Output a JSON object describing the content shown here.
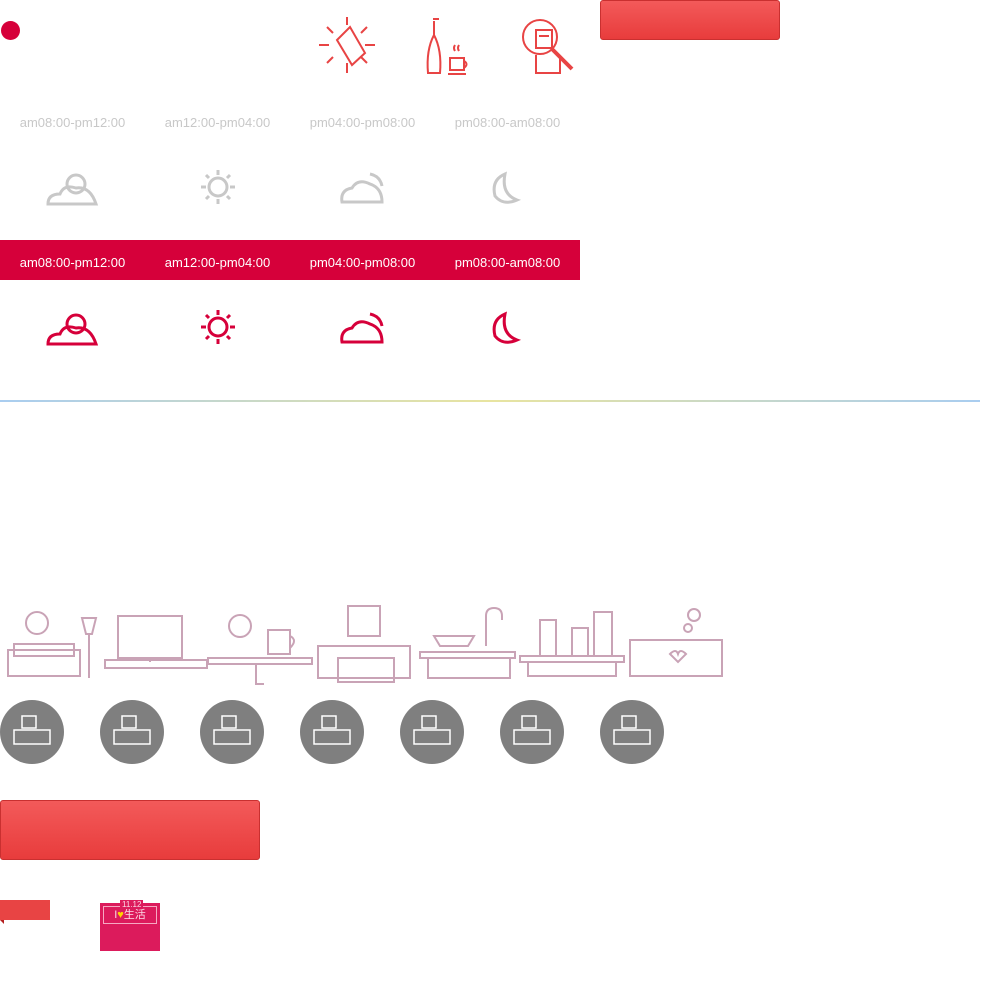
{
  "time_slots": [
    "am08:00-pm12:00",
    "am12:00-pm04:00",
    "pm04:00-pm08:00",
    "pm08:00-am08:00"
  ],
  "time_icons": [
    "sun-cloud-icon",
    "sun-icon",
    "cloud-moon-icon",
    "moon-icon"
  ],
  "top_icons": [
    "price-tag-icon",
    "bottle-coffee-icon",
    "search-document-icon"
  ],
  "rooms": [
    "living-room",
    "bedroom-tv",
    "balcony",
    "bedroom",
    "kitchen",
    "bathroom",
    "nursery"
  ],
  "badge": {
    "date": "11.12",
    "text_prefix": "I",
    "text": "生活"
  },
  "colors": {
    "accent": "#d6003a",
    "button": "#e83c3c",
    "muted": "#c8c8c8",
    "line_art": "#c9a3b6",
    "circle": "#7f7f7f",
    "badge": "#dc1b5c"
  }
}
